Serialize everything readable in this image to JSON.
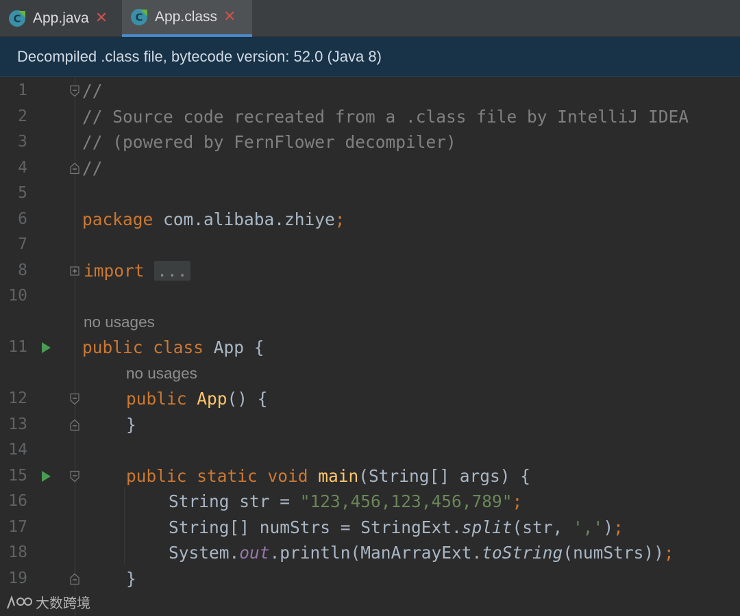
{
  "tabs": [
    {
      "label": "App.java",
      "active": false,
      "icon": "java-class-icon"
    },
    {
      "label": "App.class",
      "active": true,
      "icon": "java-class-icon"
    }
  ],
  "banner": {
    "text": "Decompiled .class file, bytecode version: 52.0 (Java 8)"
  },
  "editor": {
    "line_numbers": [
      "1",
      "2",
      "3",
      "4",
      "5",
      "6",
      "7",
      "8",
      "10",
      "11",
      "12",
      "13",
      "14",
      "15",
      "16",
      "17",
      "18",
      "19"
    ],
    "hints": {
      "usage_label": "no usages"
    },
    "code": {
      "l1": "//",
      "l2": "// Source code recreated from a .class file by IntelliJ IDEA",
      "l3": "// (powered by FernFlower decompiler)",
      "l4": "//",
      "l6_kw": "package",
      "l6_pkg": " com.alibaba.zhiye",
      "l6_semi": ";",
      "l8_kw": "import",
      "l8_fold": "...",
      "l11_kw": "public class",
      "l11_rest": " App {",
      "l12_kw": "public",
      "l12_fn": "App",
      "l12_rest": "() {",
      "l13": "}",
      "l15_kw": "public static void",
      "l15_fn": "main",
      "l15_rest": "(String[] args) {",
      "l16_a": "String str = ",
      "l16_str": "\"123,456,123,456,789\"",
      "l16_semi": ";",
      "l17_a": "String[] numStrs = StringExt.",
      "l17_it": "split",
      "l17_b": "(str, ",
      "l17_str": "','",
      "l17_c": ")",
      "l17_semi": ";",
      "l18_a": "System.",
      "l18_out": "out",
      "l18_b": ".println(ManArrayExt.",
      "l18_it": "toString",
      "l18_c": "(numStrs))",
      "l18_semi": ";",
      "l19": "}"
    }
  },
  "watermark": {
    "text": "大数跨境"
  },
  "colors": {
    "keyword": "#cc7832",
    "comment": "#808080",
    "string": "#6a8759",
    "method_decl": "#ffc66d",
    "static_field": "#9876aa",
    "default_text": "#a9b7c6",
    "banner_bg": "#183248",
    "active_tab_underline": "#4a88c7",
    "run_icon": "#499c54"
  }
}
